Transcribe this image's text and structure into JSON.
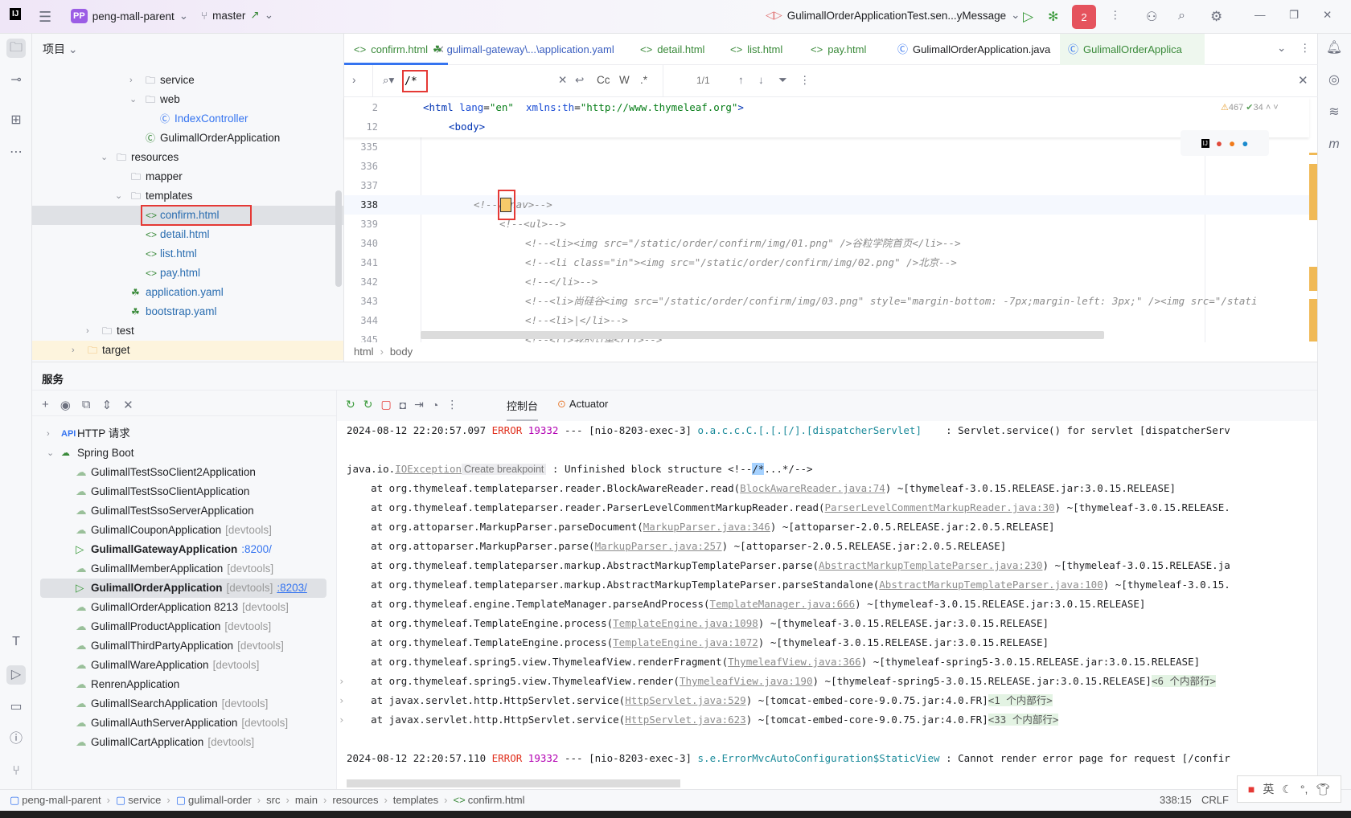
{
  "titlebar": {
    "project_badge": "PP",
    "project_name": "peng-mall-parent",
    "branch": "master",
    "run_config": "GulimallOrderApplicationTest.sen...yMessage",
    "notification_badge": "2"
  },
  "project_panel": {
    "title": "项目",
    "tree": [
      {
        "label": "service",
        "type": "folder",
        "depth": 4,
        "expanded": false
      },
      {
        "label": "web",
        "type": "folder",
        "depth": 4,
        "expanded": true
      },
      {
        "label": "IndexController",
        "type": "class",
        "depth": 5
      },
      {
        "label": "GulimallOrderApplication",
        "type": "spring-class",
        "depth": 4
      },
      {
        "label": "resources",
        "type": "folder",
        "depth": 2,
        "expanded": true
      },
      {
        "label": "mapper",
        "type": "folder",
        "depth": 3
      },
      {
        "label": "templates",
        "type": "folder",
        "depth": 3,
        "expanded": true
      },
      {
        "label": "confirm.html",
        "type": "html",
        "depth": 4,
        "selected": true
      },
      {
        "label": "detail.html",
        "type": "html",
        "depth": 4
      },
      {
        "label": "list.html",
        "type": "html",
        "depth": 4
      },
      {
        "label": "pay.html",
        "type": "html",
        "depth": 4
      },
      {
        "label": "application.yaml",
        "type": "yaml",
        "depth": 3
      },
      {
        "label": "bootstrap.yaml",
        "type": "yaml",
        "depth": 3
      },
      {
        "label": "test",
        "type": "folder",
        "depth": 1,
        "expanded": false
      },
      {
        "label": "target",
        "type": "folder-excluded",
        "depth": 0,
        "expanded": false
      }
    ]
  },
  "editor": {
    "tabs": [
      {
        "label": "confirm.html",
        "active": true,
        "icon": "html-icon"
      },
      {
        "label": "gulimall-gateway\\...\\application.yaml",
        "icon": "yaml-icon"
      },
      {
        "label": "detail.html",
        "icon": "html-icon"
      },
      {
        "label": "list.html",
        "icon": "html-icon"
      },
      {
        "label": "pay.html",
        "icon": "html-icon"
      },
      {
        "label": "GulimallOrderApplication.java",
        "icon": "java-icon"
      },
      {
        "label": "GulimallOrderApplica",
        "icon": "spring-test-icon"
      }
    ],
    "find": {
      "query": "/*",
      "match_case": "Cc",
      "words": "W",
      "regex": ".*",
      "result_count": "1/1"
    },
    "sticky_lines": [
      {
        "num": "2",
        "html": "<span class='tag'>&lt;html</span> <span class='attr'>lang</span>=<span class='val'>\"en\"</span>  <span class='attr'>xmlns:th</span>=<span class='val'>\"http://www.thymeleaf.org\"</span><span class='tag'>&gt;</span>",
        "indent": 0
      },
      {
        "num": "12",
        "html": "<span class='tag'>&lt;body&gt;</span>",
        "indent": 1
      }
    ],
    "inspections": {
      "warnings": "467",
      "ok": "34"
    },
    "lines": [
      {
        "num": "335",
        "text": "",
        "indent": 0
      },
      {
        "num": "336",
        "text": "",
        "indent": 0
      },
      {
        "num": "337",
        "text": "",
        "indent": 0
      },
      {
        "num": "338",
        "text": "<!--/*nav>-->",
        "indent": 2,
        "current": true
      },
      {
        "num": "339",
        "text": "<!--<ul>-->",
        "indent": 3
      },
      {
        "num": "340",
        "text": "<!--<li><img src=\"/static/order/confirm/img/01.png\" />谷粒学院首页</li>-->",
        "indent": 4
      },
      {
        "num": "341",
        "text": "<!--<li class=\"in\"><img src=\"/static/order/confirm/img/02.png\" />北京-->",
        "indent": 4
      },
      {
        "num": "342",
        "text": "<!--</li>-->",
        "indent": 4
      },
      {
        "num": "343",
        "text": "<!--<li>尚硅谷<img src=\"/static/order/confirm/img/03.png\" style=\"margin-bottom: -7px;margin-left: 3px;\" /><img src=\"/stati",
        "indent": 4
      },
      {
        "num": "344",
        "text": "<!--<li>|</li>-->",
        "indent": 4
      },
      {
        "num": "345",
        "text": "<!--<li>我的订单</li>-->",
        "indent": 4
      }
    ],
    "breadcrumb": [
      "html",
      "body"
    ]
  },
  "services": {
    "title": "服务",
    "tree": [
      {
        "label": "HTTP 请求",
        "group": true,
        "expanded": false,
        "icon": "api-icon"
      },
      {
        "label": "Spring Boot",
        "group": true,
        "expanded": true,
        "icon": "spring-boot-icon"
      },
      {
        "label": "GulimallTestSsoClient2Application",
        "suffix": ""
      },
      {
        "label": "GulimallTestSsoClientApplication",
        "suffix": ""
      },
      {
        "label": "GulimallTestSsoServerApplication",
        "suffix": ""
      },
      {
        "label": "GulimallCouponApplication",
        "suffix": "[devtools]"
      },
      {
        "label": "GulimallGatewayApplication",
        "suffix": "",
        "port": ":8200/",
        "running": true
      },
      {
        "label": "GulimallMemberApplication",
        "suffix": "[devtools]"
      },
      {
        "label": "GulimallOrderApplication",
        "suffix": "[devtools]",
        "port": ":8203/",
        "running": true,
        "selected": true
      },
      {
        "label": "GulimallOrderApplication 8213",
        "suffix": "[devtools]"
      },
      {
        "label": "GulimallProductApplication",
        "suffix": "[devtools]"
      },
      {
        "label": "GulimallThirdPartyApplication",
        "suffix": "[devtools]"
      },
      {
        "label": "GulimallWareApplication",
        "suffix": "[devtools]"
      },
      {
        "label": "RenrenApplication",
        "suffix": ""
      },
      {
        "label": "GulimallSearchApplication",
        "suffix": "[devtools]"
      },
      {
        "label": "GulimallAuthServerApplication",
        "suffix": "[devtools]"
      },
      {
        "label": "GulimallCartApplication",
        "suffix": "[devtools]"
      }
    ],
    "console_tabs": [
      {
        "label": "控制台",
        "active": true
      },
      {
        "label": "Actuator"
      }
    ],
    "console": [
      [
        [
          "2024-08-12 22:20:57.097 ",
          ""
        ],
        [
          "ERROR",
          "err"
        ],
        [
          " ",
          ""
        ],
        [
          "19332",
          "pid"
        ],
        [
          " --- [nio-8203-exec-3] ",
          ""
        ],
        [
          "o.a.c.c.C.[.[.[/].[dispatcherServlet]",
          "lg"
        ],
        [
          "    : Servlet.service() for servlet [dispatcherServ",
          ""
        ]
      ],
      [],
      [
        [
          "java.io.",
          ""
        ],
        [
          "IOException",
          "lnk"
        ],
        [
          "Create breakpoint",
          "chip"
        ],
        [
          " : Unfinished block structure <!--",
          ""
        ],
        [
          "/*",
          "hl"
        ],
        [
          "...*/-->",
          ""
        ]
      ],
      [
        [
          "    at org.thymeleaf.templateparser.reader.BlockAwareReader.read(",
          ""
        ],
        [
          "BlockAwareReader.java:74",
          "lnk"
        ],
        [
          ") ~[thymeleaf-3.0.15.RELEASE.jar:3.0.15.RELEASE]",
          ""
        ]
      ],
      [
        [
          "    at org.thymeleaf.templateparser.reader.ParserLevelCommentMarkupReader.read(",
          ""
        ],
        [
          "ParserLevelCommentMarkupReader.java:30",
          "lnk"
        ],
        [
          ") ~[thymeleaf-3.0.15.RELEASE.",
          ""
        ]
      ],
      [
        [
          "    at org.attoparser.MarkupParser.parseDocument(",
          ""
        ],
        [
          "MarkupParser.java:346",
          "lnk"
        ],
        [
          ") ~[attoparser-2.0.5.RELEASE.jar:2.0.5.RELEASE]",
          ""
        ]
      ],
      [
        [
          "    at org.attoparser.MarkupParser.parse(",
          ""
        ],
        [
          "MarkupParser.java:257",
          "lnk"
        ],
        [
          ") ~[attoparser-2.0.5.RELEASE.jar:2.0.5.RELEASE]",
          ""
        ]
      ],
      [
        [
          "    at org.thymeleaf.templateparser.markup.AbstractMarkupTemplateParser.parse(",
          ""
        ],
        [
          "AbstractMarkupTemplateParser.java:230",
          "lnk"
        ],
        [
          ") ~[thymeleaf-3.0.15.RELEASE.ja",
          ""
        ]
      ],
      [
        [
          "    at org.thymeleaf.templateparser.markup.AbstractMarkupTemplateParser.parseStandalone(",
          ""
        ],
        [
          "AbstractMarkupTemplateParser.java:100",
          "lnk"
        ],
        [
          ") ~[thymeleaf-3.0.15.",
          ""
        ]
      ],
      [
        [
          "    at org.thymeleaf.engine.TemplateManager.parseAndProcess(",
          ""
        ],
        [
          "TemplateManager.java:666",
          "lnk"
        ],
        [
          ") ~[thymeleaf-3.0.15.RELEASE.jar:3.0.15.RELEASE]",
          ""
        ]
      ],
      [
        [
          "    at org.thymeleaf.TemplateEngine.process(",
          ""
        ],
        [
          "TemplateEngine.java:1098",
          "lnk"
        ],
        [
          ") ~[thymeleaf-3.0.15.RELEASE.jar:3.0.15.RELEASE]",
          ""
        ]
      ],
      [
        [
          "    at org.thymeleaf.TemplateEngine.process(",
          ""
        ],
        [
          "TemplateEngine.java:1072",
          "lnk"
        ],
        [
          ") ~[thymeleaf-3.0.15.RELEASE.jar:3.0.15.RELEASE]",
          ""
        ]
      ],
      [
        [
          "    at org.thymeleaf.spring5.view.ThymeleafView.renderFragment(",
          ""
        ],
        [
          "ThymeleafView.java:366",
          "lnk"
        ],
        [
          ") ~[thymeleaf-spring5-3.0.15.RELEASE.jar:3.0.15.RELEASE]",
          ""
        ]
      ],
      [
        [
          "    at org.thymeleaf.spring5.view.ThymeleafView.render(",
          ""
        ],
        [
          "ThymeleafView.java:190",
          "lnk"
        ],
        [
          ") ~[thymeleaf-spring5-3.0.15.RELEASE.jar:3.0.15.RELEASE]",
          ""
        ],
        [
          "<6 个内部行>",
          "fold"
        ]
      ],
      [
        [
          "    at javax.servlet.http.HttpServlet.service(",
          ""
        ],
        [
          "HttpServlet.java:529",
          "lnk"
        ],
        [
          ") ~[tomcat-embed-core-9.0.75.jar:4.0.FR]",
          ""
        ],
        [
          "<1 个内部行>",
          "fold"
        ]
      ],
      [
        [
          "    at javax.servlet.http.HttpServlet.service(",
          ""
        ],
        [
          "HttpServlet.java:623",
          "lnk"
        ],
        [
          ") ~[tomcat-embed-core-9.0.75.jar:4.0.FR]",
          ""
        ],
        [
          "<33 个内部行>",
          "fold"
        ]
      ],
      [],
      [
        [
          "2024-08-12 22:20:57.110 ",
          ""
        ],
        [
          "ERROR",
          "err"
        ],
        [
          " ",
          ""
        ],
        [
          "19332",
          "pid"
        ],
        [
          " --- [nio-8203-exec-3] ",
          ""
        ],
        [
          "s.e.ErrorMvcAutoConfiguration$StaticView",
          "lg"
        ],
        [
          " : Cannot render error page for request [/confir",
          ""
        ]
      ]
    ]
  },
  "statusbar": {
    "path": [
      "peng-mall-parent",
      "service",
      "gulimall-order",
      "src",
      "main",
      "resources",
      "templates",
      "confirm.html"
    ],
    "position": "338:15",
    "line_ending": "CRLF",
    "ime": "英"
  }
}
